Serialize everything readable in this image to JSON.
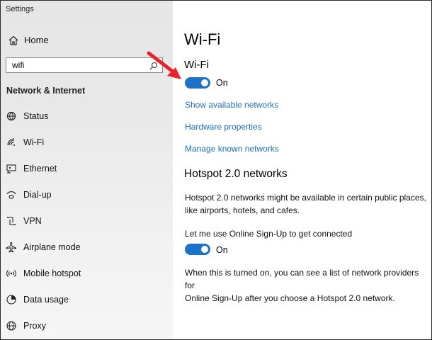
{
  "app": {
    "title": "Settings"
  },
  "sidebar": {
    "home_label": "Home",
    "search": {
      "value": "wifi",
      "placeholder": ""
    },
    "section_heading": "Network & Internet",
    "items": [
      {
        "label": "Status",
        "icon": "status-icon"
      },
      {
        "label": "Wi-Fi",
        "icon": "wifi-icon"
      },
      {
        "label": "Ethernet",
        "icon": "ethernet-icon"
      },
      {
        "label": "Dial-up",
        "icon": "dialup-icon"
      },
      {
        "label": "VPN",
        "icon": "vpn-icon"
      },
      {
        "label": "Airplane mode",
        "icon": "airplane-icon"
      },
      {
        "label": "Mobile hotspot",
        "icon": "hotspot-icon"
      },
      {
        "label": "Data usage",
        "icon": "data-usage-icon"
      },
      {
        "label": "Proxy",
        "icon": "globe-icon"
      }
    ]
  },
  "main": {
    "page_title": "Wi-Fi",
    "wifi_heading": "Wi-Fi",
    "wifi_toggle": {
      "state_label": "On",
      "on": true
    },
    "links": {
      "show_networks": "Show available networks",
      "hardware_properties": "Hardware properties",
      "manage_networks": "Manage known networks"
    },
    "hotspot": {
      "title": "Hotspot 2.0 networks",
      "description_line1": "Hotspot 2.0 networks might be available in certain public places,",
      "description_line2": "like airports, hotels, and cafes.",
      "signup_label": "Let me use Online Sign-Up to get connected",
      "signup_toggle": {
        "state_label": "On",
        "on": true
      },
      "note_line1": "When this is turned on, you can see a list of network providers for",
      "note_line2": "Online Sign-Up after you choose a Hotspot 2.0 network."
    }
  },
  "colors": {
    "accent": "#1a73c9",
    "link": "#1d6fb8",
    "annotation_arrow": "#e8242a"
  }
}
